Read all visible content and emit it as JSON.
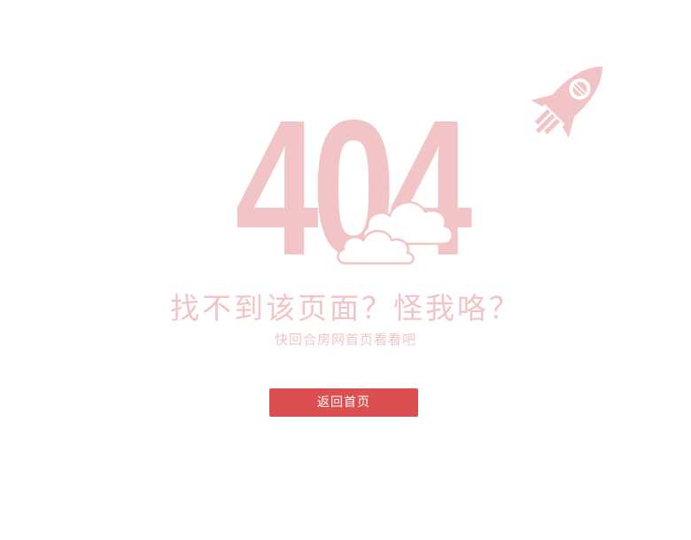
{
  "error": {
    "code": "404",
    "headline": "找不到该页面？怪我咯？",
    "subline": "快回合房网首页看看吧"
  },
  "actions": {
    "home_button_label": "返回首页"
  },
  "colors": {
    "accent": "#dc4f51",
    "illustration_pink": "#f2c4c5",
    "background": "#ffffff"
  },
  "icons": {
    "rocket": "rocket-icon",
    "cloud": "cloud-icon"
  }
}
